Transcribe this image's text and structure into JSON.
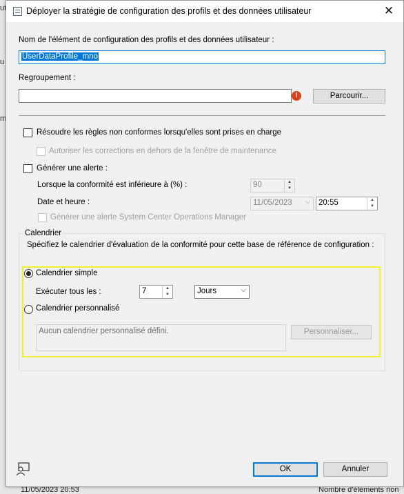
{
  "background": {
    "left_fragments": [
      "ut",
      "u",
      "m"
    ],
    "right_fragments": [
      "ite",
      "es"
    ],
    "bottom_left": "11/05/2023 20:53",
    "bottom_right": "Nombre d'éléments non"
  },
  "dialog": {
    "title": "Déployer la stratégie de configuration des profils et des données utilisateur",
    "close_glyph": "✕",
    "item_name_label": "Nom de l'élément de configuration des profils et des données utilisateur :",
    "item_name_value": "UserDataProfile_mno",
    "collection_label": "Regroupement :",
    "collection_value": "",
    "browse_label": "Parcourir...",
    "remediate_label": "Résoudre les règles non conformes lorsqu'elles sont prises en charge",
    "remediate_checked": false,
    "allow_outside_window_label": "Autoriser les corrections en dehors de la fenêtre de maintenance",
    "generate_alert_label": "Générer une alerte :",
    "generate_alert_checked": false,
    "compliance_below_label": "Lorsque la conformité est inférieure à (%) :",
    "compliance_below_value": "90",
    "datetime_label": "Date et heure :",
    "date_value": "11/05/2023",
    "time_value": "20:55",
    "scom_alert_label": "Générer une alerte System Center Operations Manager",
    "schedule_group_label": "Calendrier",
    "schedule_description": "Spécifiez le calendrier d'évaluation de la conformité pour cette base de référence de configuration :",
    "simple_schedule_label": "Calendrier simple",
    "simple_schedule_selected": true,
    "run_every_label": "Exécuter tous les :",
    "run_every_value": "7",
    "run_every_unit": "Jours",
    "custom_schedule_label": "Calendrier personnalisé",
    "custom_schedule_text": "Aucun calendrier personnalisé défini.",
    "customize_label": "Personnaliser...",
    "ok_label": "OK",
    "cancel_label": "Annuler"
  },
  "colors": {
    "highlight": "#f2ef32",
    "accent": "#0078d7",
    "warning": "#d9441c"
  },
  "icons": [
    "dialog-icon",
    "close-icon",
    "warning-icon",
    "spin-up-icon",
    "spin-down-icon",
    "chevron-down-icon",
    "user-help-icon"
  ]
}
